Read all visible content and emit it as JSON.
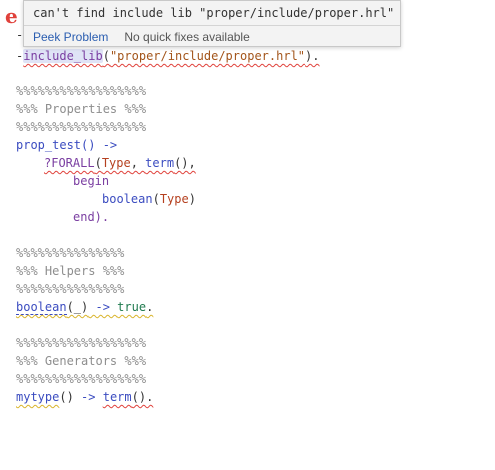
{
  "hover": {
    "error_icon": "error-icon",
    "message": "can't find include lib \"proper/include/proper.hrl\"",
    "actions": {
      "peek_problem": "Peek Problem",
      "no_quick_fixes": "No quick fixes available"
    }
  },
  "editor": {
    "colors": {
      "background": "#ffffff",
      "comment": "#8e8e8e",
      "function": "#3b4cc0",
      "string": "#a3551b",
      "macro": "#7a3ea1",
      "type": "#b5401f",
      "error_squiggle": "#e0413b",
      "hover_link": "#2a5db0"
    },
    "gutter_mark": "-",
    "include": {
      "prefix": "-",
      "directive": "include_lib",
      "open": "(",
      "path": "\"proper/include/proper.hrl\"",
      "close": ")."
    },
    "properties": {
      "banner_top": "%%%%%%%%%%%%%%%%%%",
      "title": "%%% Properties %%%",
      "banner_bottom": "%%%%%%%%%%%%%%%%%%"
    },
    "prop_test": {
      "name": "prop_test",
      "head_rest": "() ->",
      "forall_macro": "?FORALL",
      "forall_open": "(",
      "forall_type": "Type",
      "forall_sep": ", ",
      "forall_term": "term",
      "forall_rest": "(),",
      "begin": "begin",
      "boolean_fn": "boolean",
      "boolean_open": "(",
      "boolean_arg": "Type",
      "boolean_close": ")",
      "end": "end)."
    },
    "helpers": {
      "banner_top": "%%%%%%%%%%%%%%%",
      "title": "%%% Helpers %%%",
      "banner_bottom": "%%%%%%%%%%%%%%%",
      "line": {
        "name": "boolean",
        "args": "(_)",
        "arrow": " -> ",
        "value": "true",
        "end": "."
      }
    },
    "generators": {
      "banner_top": "%%%%%%%%%%%%%%%%%%",
      "title": "%%% Generators %%%",
      "banner_bottom": "%%%%%%%%%%%%%%%%%%",
      "line": {
        "name": "mytype",
        "args": "()",
        "arrow": " -> ",
        "value": "term",
        "end": "()."
      }
    }
  }
}
